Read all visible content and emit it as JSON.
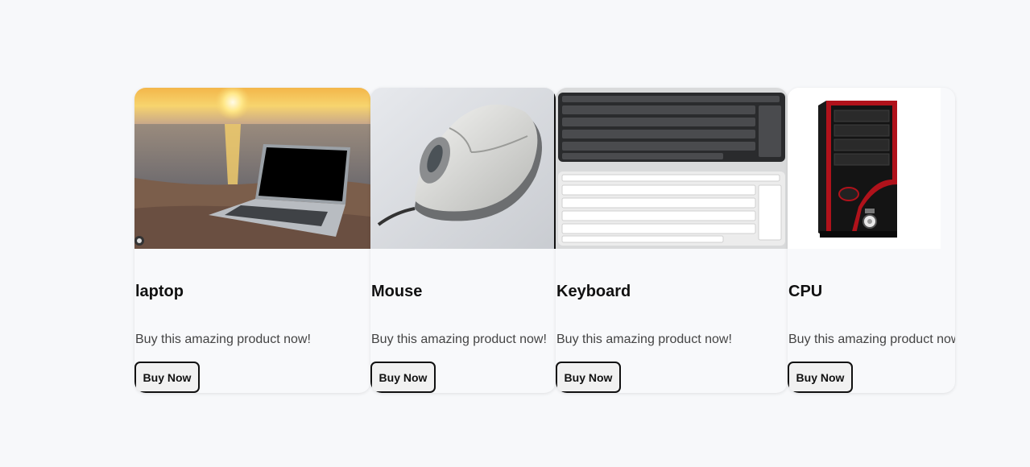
{
  "products": [
    {
      "name": "laptop",
      "image": "laptop-on-beach-at-sunset",
      "description": "Buy this amazing product now!",
      "button_label": "Buy Now"
    },
    {
      "name": "Mouse",
      "image": "computer-mouse",
      "description": "Buy this amazing product now!",
      "button_label": "Buy Now"
    },
    {
      "name": "Keyboard",
      "image": "black-and-white-keyboards",
      "description": "Buy this amazing product now!",
      "button_label": "Buy Now"
    },
    {
      "name": "CPU",
      "image": "pc-tower-case",
      "description": "Buy this amazing product now!",
      "button_label": "Buy Now"
    }
  ],
  "colors": {
    "page_background": "#f7f8fa",
    "card_background": "#f8f9fb",
    "button_border": "#111111",
    "case_accent": "#b0121b"
  }
}
